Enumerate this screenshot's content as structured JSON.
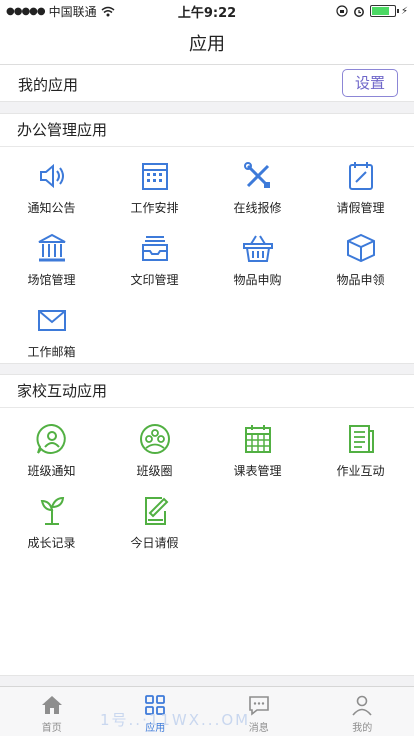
{
  "status": {
    "carrier": "中国联通",
    "time": "上午9:22"
  },
  "nav": {
    "title": "应用"
  },
  "my_apps": {
    "title": "我的应用",
    "settings": "设置"
  },
  "office": {
    "title": "办公管理应用",
    "items": [
      "通知公告",
      "工作安排",
      "在线报修",
      "请假管理",
      "场馆管理",
      "文印管理",
      "物品申购",
      "物品申领",
      "工作邮箱"
    ],
    "icon_color": "#3d7ad9"
  },
  "home_school": {
    "title": "家校互动应用",
    "items": [
      "班级通知",
      "班级圈",
      "课表管理",
      "作业互动",
      "成长记录",
      "今日请假"
    ],
    "icon_color": "#52b043"
  },
  "tabbar": {
    "tabs": [
      "首页",
      "应用",
      "消息",
      "我的"
    ],
    "active": "应用",
    "watermark": "1号..·11WX...OM"
  }
}
